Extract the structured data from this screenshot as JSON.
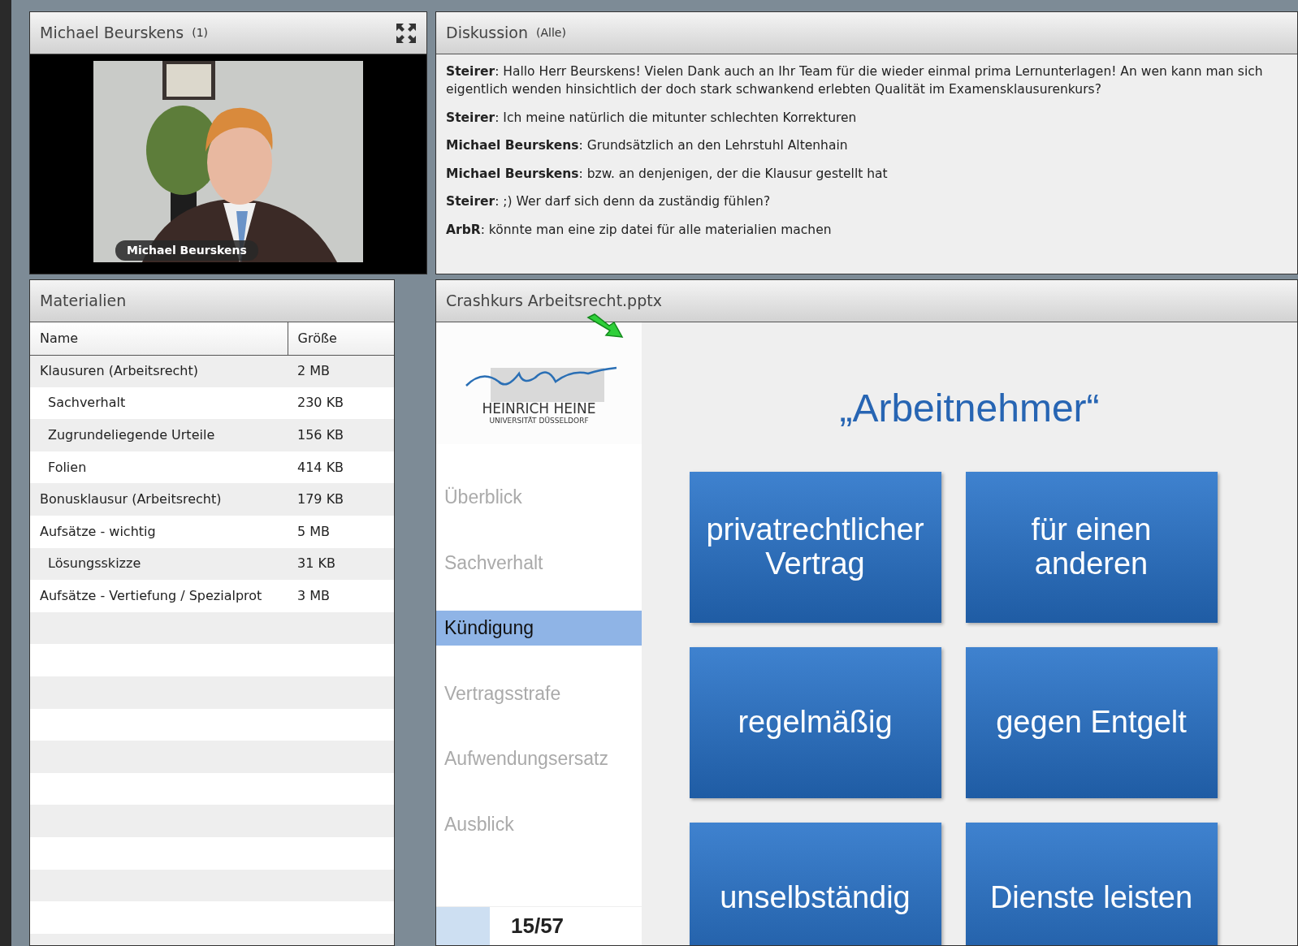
{
  "video_pod": {
    "title": "Michael Beurskens",
    "count": "(1)",
    "caption": "Michael Beurskens"
  },
  "chat": {
    "title": "Diskussion",
    "filter": "(Alle)",
    "messages": [
      {
        "text": "**Steirer**: Hallo Herr Beurskens! Vielen Dank auch an Ihr Team für die wieder einmal prima Lernunterlagen! An wen kann man sich eigentlich wenden hinsichtlich der doch stark schwankend erlebten Qualität im Examensklausurenkurs?"
      },
      {
        "text": "**Steirer**: Ich meine natürlich die mitunter schlechten Korrekturen"
      },
      {
        "text": "**Michael Beurskens**: Grundsätzlich an den Lehrstuhl Altenhain"
      },
      {
        "text": "**Michael Beurskens**: bzw. an denjenigen, der die Klausur gestellt hat"
      },
      {
        "text": "**Steirer**: ;)   Wer darf sich denn da zuständig fühlen?"
      },
      {
        "text": "**ArbR**: könnte man eine zip datei für alle materialien machen"
      }
    ]
  },
  "files": {
    "title": "Materialien",
    "columns": [
      "Name",
      "Größe"
    ],
    "rows": [
      {
        "name": "Klausuren (Arbeitsrecht)",
        "size": "2 MB",
        "children": [
          {
            "name": "Sachverhalt",
            "size": "230 KB"
          },
          {
            "name": "Zugrundeliegende Urteile",
            "size": "156 KB"
          },
          {
            "name": "Folien",
            "size": "414 KB"
          }
        ]
      },
      {
        "name": "Bonusklausur (Arbeitsrecht)",
        "size": "179 KB"
      },
      {
        "name": "Aufsätze  - wichtig",
        "size": "5 MB",
        "children": [
          {
            "name": "Lösungsskizze",
            "size": "31 KB"
          }
        ]
      },
      {
        "name": "Aufsätze - Vertiefung / Spezialprot",
        "size": "3 MB"
      }
    ]
  },
  "presentation": {
    "title": "Crashkurs Arbeitsrecht.pptx",
    "logo": {
      "line1": "HEINRICH HEINE",
      "line2": "UNIVERSITÄT DÜSSELDORF"
    },
    "menu": [
      {
        "label": "Überblick",
        "selected": false
      },
      {
        "label": "Sachverhalt",
        "selected": false
      },
      {
        "label": "Kündigung",
        "selected": true
      },
      {
        "label": "Vertragsstrafe",
        "selected": false
      },
      {
        "label": "Aufwendungsersatz",
        "selected": false
      },
      {
        "label": "Ausblick",
        "selected": false
      }
    ],
    "progress": {
      "level": 0.26,
      "label": "15/57"
    },
    "slide_title": "„Arbeitnehmer“",
    "tiles": [
      "privatrechtlicher Vertrag",
      "für einen anderen",
      "regelmäßig",
      "gegen Entgelt",
      "unselbständig",
      "Dienste leisten"
    ]
  }
}
